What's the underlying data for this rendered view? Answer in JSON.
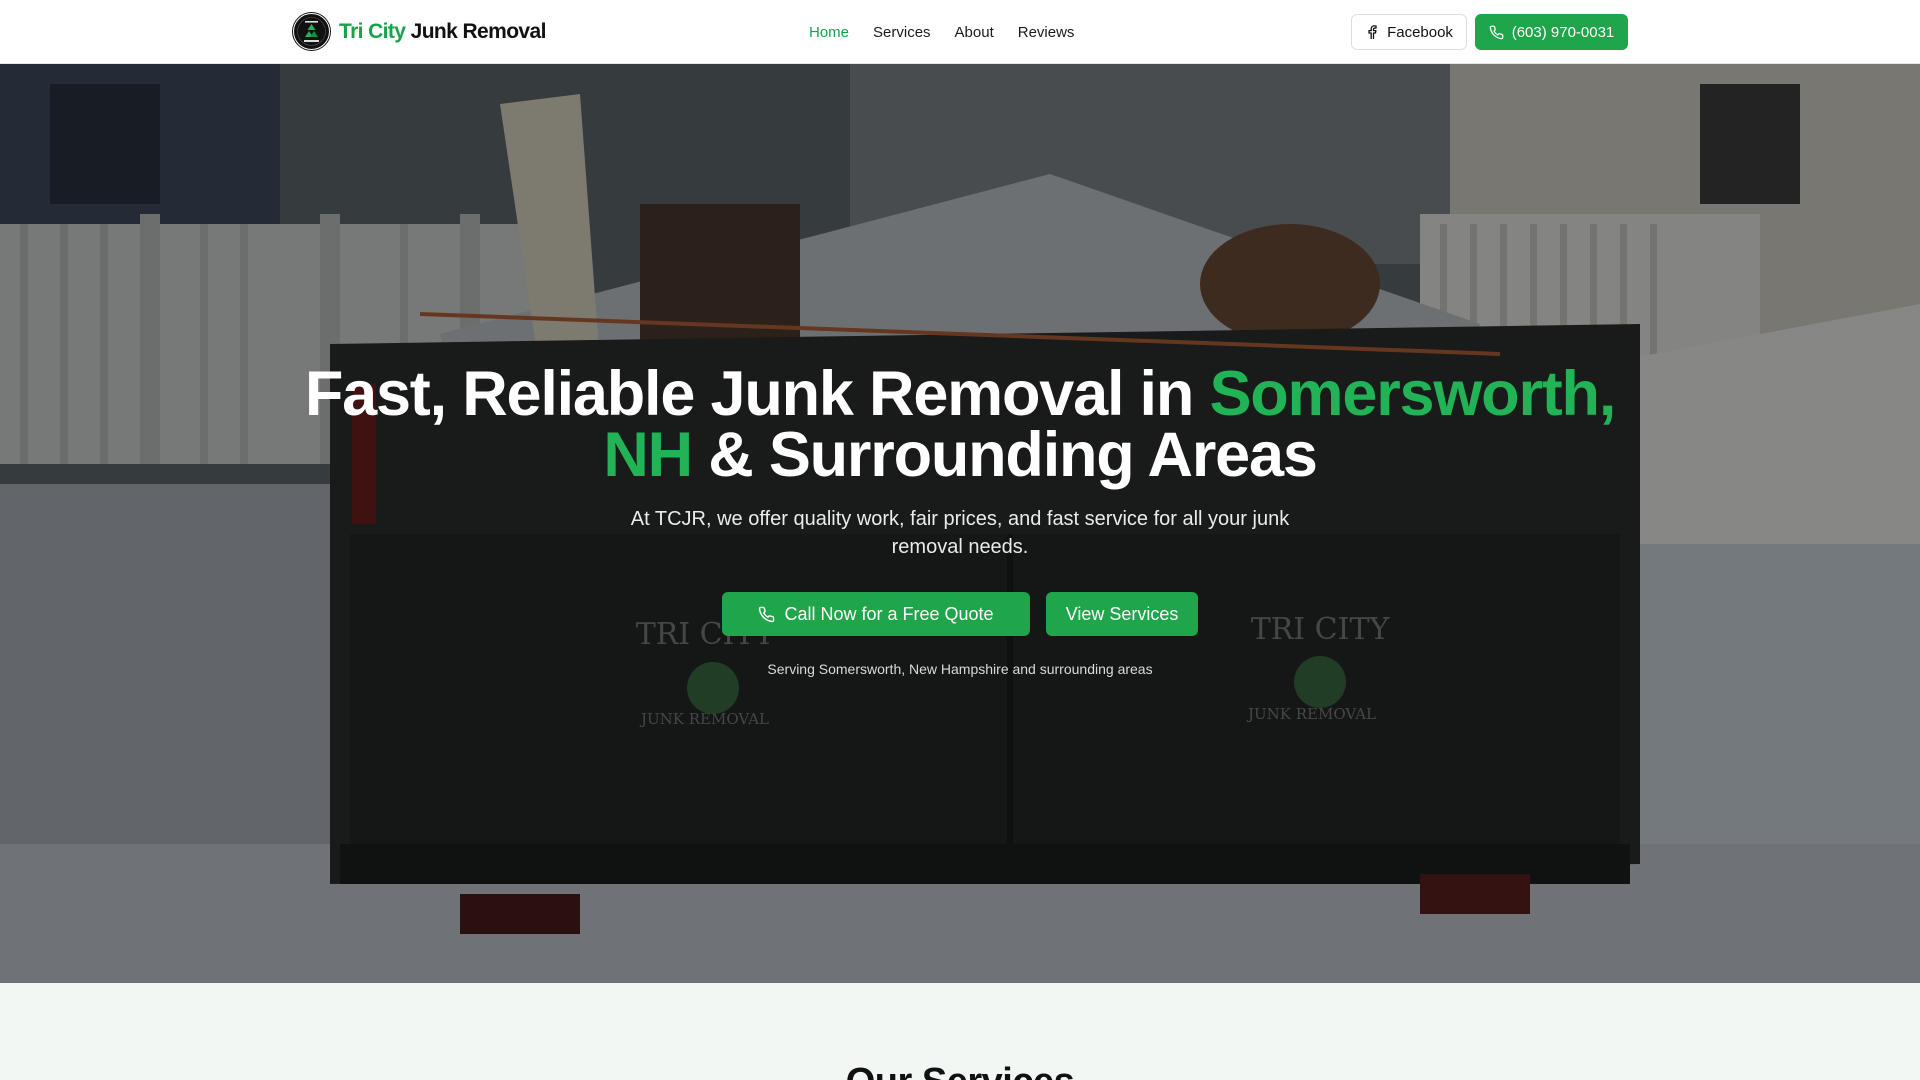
{
  "header": {
    "logo_text_accent": "Tri City",
    "logo_text_rest": " Junk Removal",
    "nav": [
      {
        "label": "Home",
        "active": true
      },
      {
        "label": "Services",
        "active": false
      },
      {
        "label": "About",
        "active": false
      },
      {
        "label": "Reviews",
        "active": false
      }
    ],
    "facebook_label": "Facebook",
    "phone_label": "(603) 970-0031"
  },
  "hero": {
    "title_part1": "Fast, Reliable Junk Removal in ",
    "title_highlight1": "Somersworth,",
    "title_highlight2": "NH",
    "title_part2": " & Surrounding Areas",
    "subtitle": "At TCJR, we offer quality work, fair prices, and fast service for all your junk removal needs.",
    "cta_call": "Call Now for a Free Quote",
    "cta_services": "View Services",
    "serving": "Serving Somersworth, New Hampshire and surrounding areas"
  },
  "services": {
    "title": "Our Services"
  },
  "colors": {
    "brand_green": "#1fa64b",
    "highlight_green": "#22b357"
  },
  "icons": {
    "facebook": "facebook-icon",
    "phone": "phone-icon",
    "logo": "recycle-logo-icon"
  }
}
